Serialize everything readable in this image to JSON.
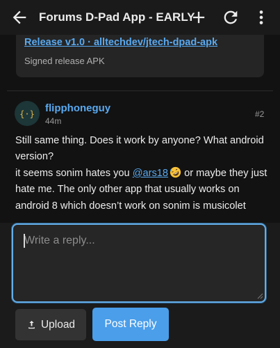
{
  "appbar": {
    "title": "Forums D-Pad App - EARLY",
    "icons": [
      "arrow-back-icon",
      "plus-icon",
      "refresh-icon",
      "more-vert-icon"
    ]
  },
  "release": {
    "link_text": "Release v1.0 · alltechdev/jtech-dpad-apk",
    "description": "Signed release APK"
  },
  "post": {
    "author": "flipphoneguy",
    "time": "44m",
    "number": "#2",
    "avatar_glyph": "{·}",
    "line1": "Still same thing. Does it work by anyone? What android",
    "line2": "version?",
    "line3_before": "it seems sonim hates you ",
    "mention": "@ars18",
    "emoji": "rolling-on-floor-laughing-emoji",
    "line3_after": " or maybe they just",
    "line4": "hate me. The only other app that usually works on",
    "line5": "android 8 which doesn’t work on sonim is musicolet"
  },
  "composer": {
    "placeholder": "Write a reply...",
    "value": "",
    "upload_label": "Upload",
    "post_label": "Post Reply"
  },
  "colors": {
    "accent": "#4a9eea",
    "link": "#59a9f0",
    "background": "#121212",
    "appbar": "#1a1a1a",
    "card": "#252525"
  }
}
